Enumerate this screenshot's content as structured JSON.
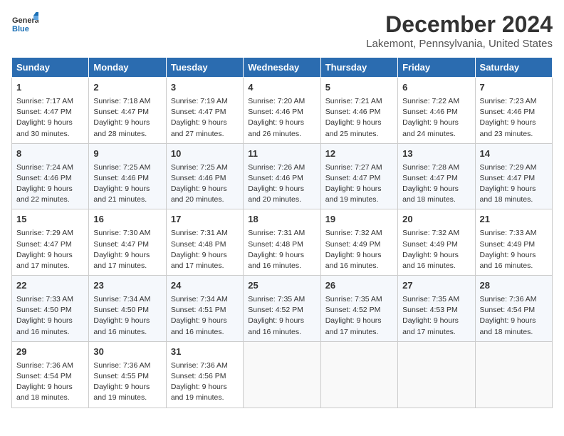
{
  "header": {
    "logo_general": "General",
    "logo_blue": "Blue",
    "month_title": "December 2024",
    "location": "Lakemont, Pennsylvania, United States"
  },
  "calendar": {
    "days_of_week": [
      "Sunday",
      "Monday",
      "Tuesday",
      "Wednesday",
      "Thursday",
      "Friday",
      "Saturday"
    ],
    "weeks": [
      [
        null,
        null,
        null,
        null,
        null,
        null,
        null
      ]
    ]
  },
  "cells": {
    "empty": "",
    "w1": [
      {
        "num": "1",
        "rise": "Sunrise: 7:17 AM",
        "set": "Sunset: 4:47 PM",
        "day": "Daylight: 9 hours and 30 minutes."
      },
      {
        "num": "2",
        "rise": "Sunrise: 7:18 AM",
        "set": "Sunset: 4:47 PM",
        "day": "Daylight: 9 hours and 28 minutes."
      },
      {
        "num": "3",
        "rise": "Sunrise: 7:19 AM",
        "set": "Sunset: 4:47 PM",
        "day": "Daylight: 9 hours and 27 minutes."
      },
      {
        "num": "4",
        "rise": "Sunrise: 7:20 AM",
        "set": "Sunset: 4:46 PM",
        "day": "Daylight: 9 hours and 26 minutes."
      },
      {
        "num": "5",
        "rise": "Sunrise: 7:21 AM",
        "set": "Sunset: 4:46 PM",
        "day": "Daylight: 9 hours and 25 minutes."
      },
      {
        "num": "6",
        "rise": "Sunrise: 7:22 AM",
        "set": "Sunset: 4:46 PM",
        "day": "Daylight: 9 hours and 24 minutes."
      },
      {
        "num": "7",
        "rise": "Sunrise: 7:23 AM",
        "set": "Sunset: 4:46 PM",
        "day": "Daylight: 9 hours and 23 minutes."
      }
    ],
    "w2": [
      {
        "num": "8",
        "rise": "Sunrise: 7:24 AM",
        "set": "Sunset: 4:46 PM",
        "day": "Daylight: 9 hours and 22 minutes."
      },
      {
        "num": "9",
        "rise": "Sunrise: 7:25 AM",
        "set": "Sunset: 4:46 PM",
        "day": "Daylight: 9 hours and 21 minutes."
      },
      {
        "num": "10",
        "rise": "Sunrise: 7:25 AM",
        "set": "Sunset: 4:46 PM",
        "day": "Daylight: 9 hours and 20 minutes."
      },
      {
        "num": "11",
        "rise": "Sunrise: 7:26 AM",
        "set": "Sunset: 4:46 PM",
        "day": "Daylight: 9 hours and 20 minutes."
      },
      {
        "num": "12",
        "rise": "Sunrise: 7:27 AM",
        "set": "Sunset: 4:47 PM",
        "day": "Daylight: 9 hours and 19 minutes."
      },
      {
        "num": "13",
        "rise": "Sunrise: 7:28 AM",
        "set": "Sunset: 4:47 PM",
        "day": "Daylight: 9 hours and 18 minutes."
      },
      {
        "num": "14",
        "rise": "Sunrise: 7:29 AM",
        "set": "Sunset: 4:47 PM",
        "day": "Daylight: 9 hours and 18 minutes."
      }
    ],
    "w3": [
      {
        "num": "15",
        "rise": "Sunrise: 7:29 AM",
        "set": "Sunset: 4:47 PM",
        "day": "Daylight: 9 hours and 17 minutes."
      },
      {
        "num": "16",
        "rise": "Sunrise: 7:30 AM",
        "set": "Sunset: 4:47 PM",
        "day": "Daylight: 9 hours and 17 minutes."
      },
      {
        "num": "17",
        "rise": "Sunrise: 7:31 AM",
        "set": "Sunset: 4:48 PM",
        "day": "Daylight: 9 hours and 17 minutes."
      },
      {
        "num": "18",
        "rise": "Sunrise: 7:31 AM",
        "set": "Sunset: 4:48 PM",
        "day": "Daylight: 9 hours and 16 minutes."
      },
      {
        "num": "19",
        "rise": "Sunrise: 7:32 AM",
        "set": "Sunset: 4:49 PM",
        "day": "Daylight: 9 hours and 16 minutes."
      },
      {
        "num": "20",
        "rise": "Sunrise: 7:32 AM",
        "set": "Sunset: 4:49 PM",
        "day": "Daylight: 9 hours and 16 minutes."
      },
      {
        "num": "21",
        "rise": "Sunrise: 7:33 AM",
        "set": "Sunset: 4:49 PM",
        "day": "Daylight: 9 hours and 16 minutes."
      }
    ],
    "w4": [
      {
        "num": "22",
        "rise": "Sunrise: 7:33 AM",
        "set": "Sunset: 4:50 PM",
        "day": "Daylight: 9 hours and 16 minutes."
      },
      {
        "num": "23",
        "rise": "Sunrise: 7:34 AM",
        "set": "Sunset: 4:50 PM",
        "day": "Daylight: 9 hours and 16 minutes."
      },
      {
        "num": "24",
        "rise": "Sunrise: 7:34 AM",
        "set": "Sunset: 4:51 PM",
        "day": "Daylight: 9 hours and 16 minutes."
      },
      {
        "num": "25",
        "rise": "Sunrise: 7:35 AM",
        "set": "Sunset: 4:52 PM",
        "day": "Daylight: 9 hours and 16 minutes."
      },
      {
        "num": "26",
        "rise": "Sunrise: 7:35 AM",
        "set": "Sunset: 4:52 PM",
        "day": "Daylight: 9 hours and 17 minutes."
      },
      {
        "num": "27",
        "rise": "Sunrise: 7:35 AM",
        "set": "Sunset: 4:53 PM",
        "day": "Daylight: 9 hours and 17 minutes."
      },
      {
        "num": "28",
        "rise": "Sunrise: 7:36 AM",
        "set": "Sunset: 4:54 PM",
        "day": "Daylight: 9 hours and 18 minutes."
      }
    ],
    "w5": [
      {
        "num": "29",
        "rise": "Sunrise: 7:36 AM",
        "set": "Sunset: 4:54 PM",
        "day": "Daylight: 9 hours and 18 minutes."
      },
      {
        "num": "30",
        "rise": "Sunrise: 7:36 AM",
        "set": "Sunset: 4:55 PM",
        "day": "Daylight: 9 hours and 19 minutes."
      },
      {
        "num": "31",
        "rise": "Sunrise: 7:36 AM",
        "set": "Sunset: 4:56 PM",
        "day": "Daylight: 9 hours and 19 minutes."
      },
      null,
      null,
      null,
      null
    ]
  }
}
